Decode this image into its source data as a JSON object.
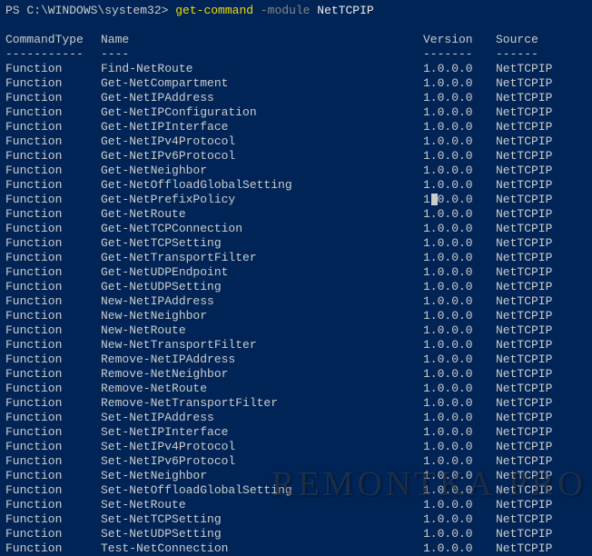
{
  "prompt": {
    "path": "PS C:\\WINDOWS\\system32> ",
    "command": "get-command",
    "flag": " -module ",
    "arg": "NetTCPIP"
  },
  "headers": {
    "type": "CommandType",
    "name": "Name",
    "version": "Version",
    "source": "Source"
  },
  "dashes": {
    "type": "-----------",
    "name": "----",
    "version": "-------",
    "source": "------"
  },
  "rows": [
    {
      "type": "Function",
      "name": "Find-NetRoute",
      "version": "1.0.0.0",
      "source": "NetTCPIP",
      "cursor": false
    },
    {
      "type": "Function",
      "name": "Get-NetCompartment",
      "version": "1.0.0.0",
      "source": "NetTCPIP",
      "cursor": false
    },
    {
      "type": "Function",
      "name": "Get-NetIPAddress",
      "version": "1.0.0.0",
      "source": "NetTCPIP",
      "cursor": false
    },
    {
      "type": "Function",
      "name": "Get-NetIPConfiguration",
      "version": "1.0.0.0",
      "source": "NetTCPIP",
      "cursor": false
    },
    {
      "type": "Function",
      "name": "Get-NetIPInterface",
      "version": "1.0.0.0",
      "source": "NetTCPIP",
      "cursor": false
    },
    {
      "type": "Function",
      "name": "Get-NetIPv4Protocol",
      "version": "1.0.0.0",
      "source": "NetTCPIP",
      "cursor": false
    },
    {
      "type": "Function",
      "name": "Get-NetIPv6Protocol",
      "version": "1.0.0.0",
      "source": "NetTCPIP",
      "cursor": false
    },
    {
      "type": "Function",
      "name": "Get-NetNeighbor",
      "version": "1.0.0.0",
      "source": "NetTCPIP",
      "cursor": false
    },
    {
      "type": "Function",
      "name": "Get-NetOffloadGlobalSetting",
      "version": "1.0.0.0",
      "source": "NetTCPIP",
      "cursor": false
    },
    {
      "type": "Function",
      "name": "Get-NetPrefixPolicy",
      "version": "1.0.0.0",
      "source": "NetTCPIP",
      "cursor": true
    },
    {
      "type": "Function",
      "name": "Get-NetRoute",
      "version": "1.0.0.0",
      "source": "NetTCPIP",
      "cursor": false
    },
    {
      "type": "Function",
      "name": "Get-NetTCPConnection",
      "version": "1.0.0.0",
      "source": "NetTCPIP",
      "cursor": false
    },
    {
      "type": "Function",
      "name": "Get-NetTCPSetting",
      "version": "1.0.0.0",
      "source": "NetTCPIP",
      "cursor": false
    },
    {
      "type": "Function",
      "name": "Get-NetTransportFilter",
      "version": "1.0.0.0",
      "source": "NetTCPIP",
      "cursor": false
    },
    {
      "type": "Function",
      "name": "Get-NetUDPEndpoint",
      "version": "1.0.0.0",
      "source": "NetTCPIP",
      "cursor": false
    },
    {
      "type": "Function",
      "name": "Get-NetUDPSetting",
      "version": "1.0.0.0",
      "source": "NetTCPIP",
      "cursor": false
    },
    {
      "type": "Function",
      "name": "New-NetIPAddress",
      "version": "1.0.0.0",
      "source": "NetTCPIP",
      "cursor": false
    },
    {
      "type": "Function",
      "name": "New-NetNeighbor",
      "version": "1.0.0.0",
      "source": "NetTCPIP",
      "cursor": false
    },
    {
      "type": "Function",
      "name": "New-NetRoute",
      "version": "1.0.0.0",
      "source": "NetTCPIP",
      "cursor": false
    },
    {
      "type": "Function",
      "name": "New-NetTransportFilter",
      "version": "1.0.0.0",
      "source": "NetTCPIP",
      "cursor": false
    },
    {
      "type": "Function",
      "name": "Remove-NetIPAddress",
      "version": "1.0.0.0",
      "source": "NetTCPIP",
      "cursor": false
    },
    {
      "type": "Function",
      "name": "Remove-NetNeighbor",
      "version": "1.0.0.0",
      "source": "NetTCPIP",
      "cursor": false
    },
    {
      "type": "Function",
      "name": "Remove-NetRoute",
      "version": "1.0.0.0",
      "source": "NetTCPIP",
      "cursor": false
    },
    {
      "type": "Function",
      "name": "Remove-NetTransportFilter",
      "version": "1.0.0.0",
      "source": "NetTCPIP",
      "cursor": false
    },
    {
      "type": "Function",
      "name": "Set-NetIPAddress",
      "version": "1.0.0.0",
      "source": "NetTCPIP",
      "cursor": false
    },
    {
      "type": "Function",
      "name": "Set-NetIPInterface",
      "version": "1.0.0.0",
      "source": "NetTCPIP",
      "cursor": false
    },
    {
      "type": "Function",
      "name": "Set-NetIPv4Protocol",
      "version": "1.0.0.0",
      "source": "NetTCPIP",
      "cursor": false
    },
    {
      "type": "Function",
      "name": "Set-NetIPv6Protocol",
      "version": "1.0.0.0",
      "source": "NetTCPIP",
      "cursor": false
    },
    {
      "type": "Function",
      "name": "Set-NetNeighbor",
      "version": "1.0.0.0",
      "source": "NetTCPIP",
      "cursor": false
    },
    {
      "type": "Function",
      "name": "Set-NetOffloadGlobalSetting",
      "version": "1.0.0.0",
      "source": "NetTCPIP",
      "cursor": false
    },
    {
      "type": "Function",
      "name": "Set-NetRoute",
      "version": "1.0.0.0",
      "source": "NetTCPIP",
      "cursor": false
    },
    {
      "type": "Function",
      "name": "Set-NetTCPSetting",
      "version": "1.0.0.0",
      "source": "NetTCPIP",
      "cursor": false
    },
    {
      "type": "Function",
      "name": "Set-NetUDPSetting",
      "version": "1.0.0.0",
      "source": "NetTCPIP",
      "cursor": false
    },
    {
      "type": "Function",
      "name": "Test-NetConnection",
      "version": "1.0.0.0",
      "source": "NetTCPIP",
      "cursor": false
    }
  ],
  "watermark": "REMONTKA.PRO"
}
